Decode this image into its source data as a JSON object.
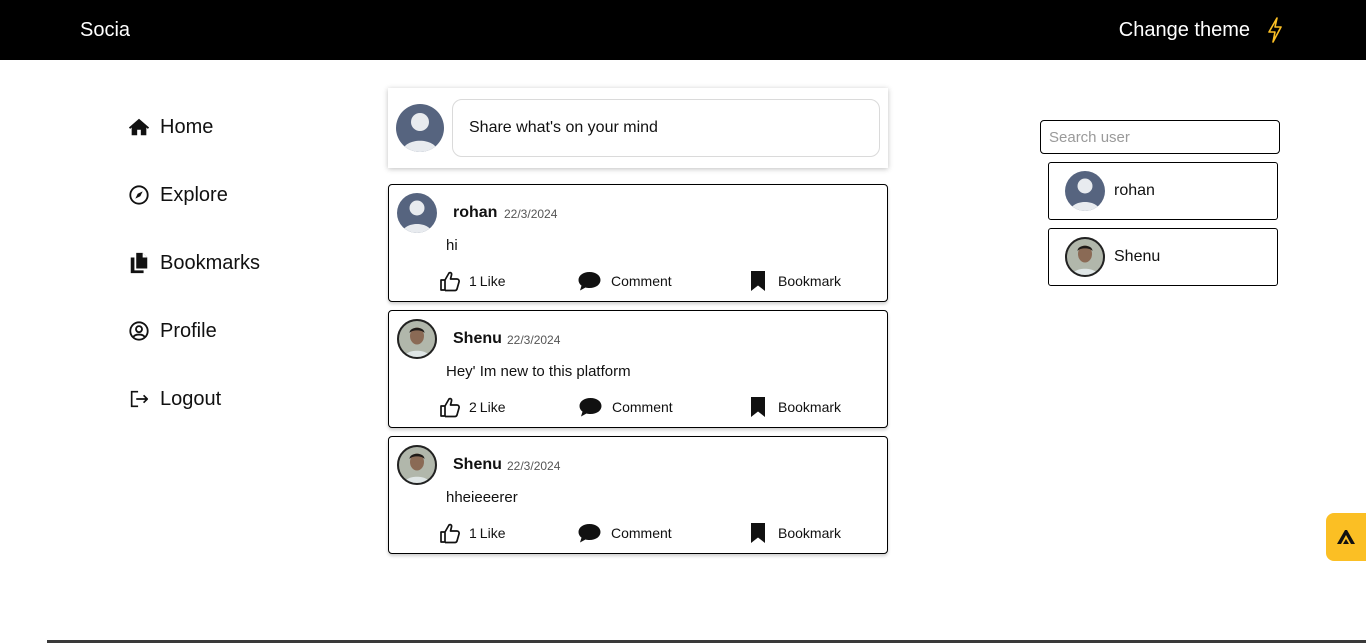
{
  "header": {
    "brand": "Socia",
    "theme_label": "Change theme",
    "theme_icon": "lightning-bolt-icon",
    "accent_color": "#fbbf24"
  },
  "nav": {
    "items": [
      {
        "label": "Home",
        "icon": "home-icon"
      },
      {
        "label": "Explore",
        "icon": "compass-icon"
      },
      {
        "label": "Bookmarks",
        "icon": "documents-icon"
      },
      {
        "label": "Profile",
        "icon": "user-circle-icon"
      },
      {
        "label": "Logout",
        "icon": "logout-icon"
      }
    ]
  },
  "composer": {
    "placeholder": "Share what's on your mind"
  },
  "posts": [
    {
      "author": "rohan",
      "date": "22/3/2024",
      "text": "hi",
      "likes": "1",
      "like_label": "Like",
      "comment_label": "Comment",
      "bookmark_label": "Bookmark"
    },
    {
      "author": "Shenu",
      "date": "22/3/2024",
      "text": "Hey' Im new to this platform",
      "likes": "2",
      "like_label": "Like",
      "comment_label": "Comment",
      "bookmark_label": "Bookmark"
    },
    {
      "author": "Shenu",
      "date": "22/3/2024",
      "text": "hheieeerer",
      "likes": "1",
      "like_label": "Like",
      "comment_label": "Comment",
      "bookmark_label": "Bookmark"
    }
  ],
  "sidebar": {
    "search_placeholder": "Search user",
    "users": [
      {
        "name": "rohan"
      },
      {
        "name": "Shenu"
      }
    ]
  }
}
